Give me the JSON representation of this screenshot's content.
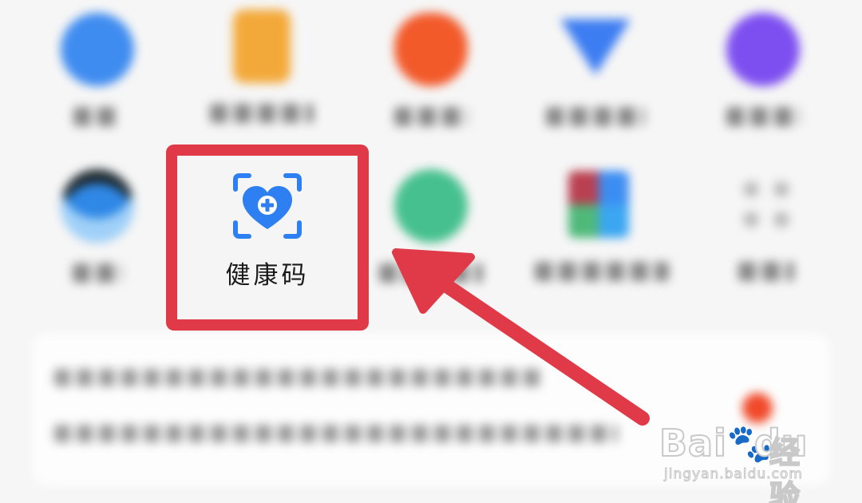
{
  "highlighted_app": {
    "label": "健康码",
    "icon": "health-code-scan-heart-icon"
  },
  "blurred_row_1": [
    {
      "icon": "blue-circle-app-icon",
      "color": "#3f8cf0"
    },
    {
      "icon": "orange-tablet-app-icon",
      "color": "#f3a93a"
    },
    {
      "icon": "red-apple-app-icon",
      "color": "#f25a2a"
    },
    {
      "icon": "blue-shield-app-icon",
      "color": "#3d7df2"
    },
    {
      "icon": "purple-circle-app-icon",
      "color": "#7d4ff0"
    }
  ],
  "blurred_row_2": [
    {
      "icon": "dark-bowl-app-icon",
      "color": "#2f88e6"
    },
    {
      "icon": "green-cat-app-icon",
      "color": "#46c08e"
    },
    {
      "icon": "colorful-grid-app-icon",
      "color": "#3b8df2"
    },
    {
      "icon": "more-dots-icon",
      "color": "#b7b7b7"
    }
  ],
  "colors": {
    "highlight_border": "#e03a48",
    "arrow": "#e03a48",
    "health_icon_blue": "#2d7ff2"
  },
  "watermark": {
    "brand": "Bai",
    "brand_tail": "du",
    "cn": "经验",
    "url": "jingyan.baidu.com"
  }
}
